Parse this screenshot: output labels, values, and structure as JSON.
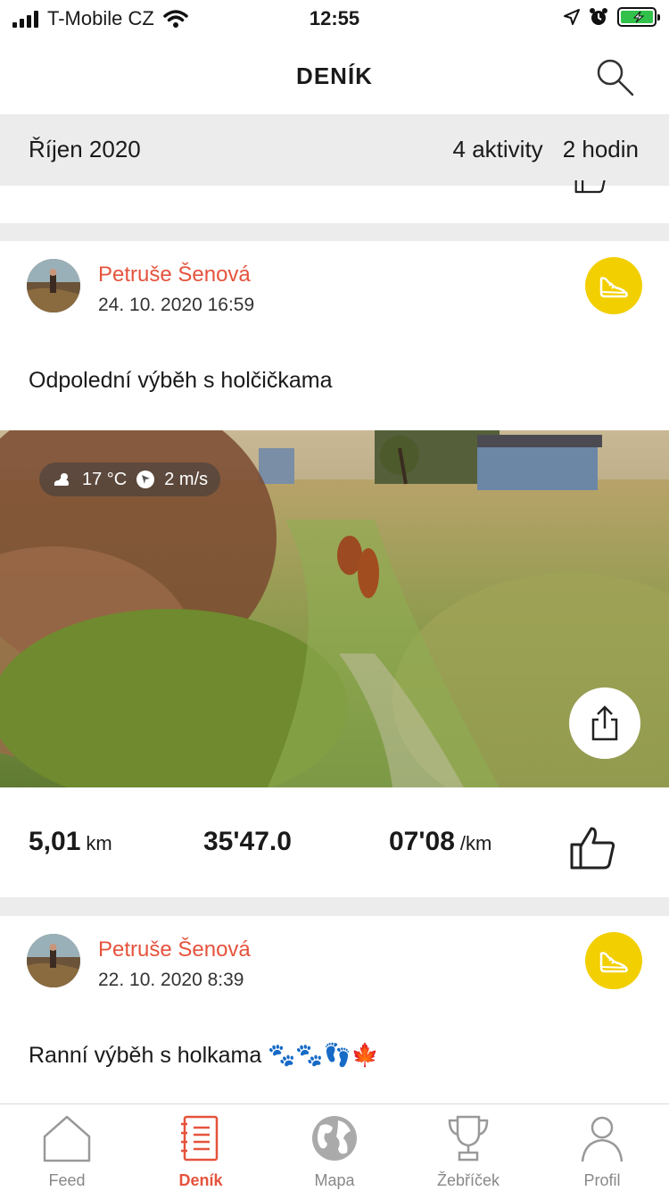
{
  "status_bar": {
    "carrier": "T-Mobile CZ",
    "time": "12:55"
  },
  "header": {
    "title": "DENÍK"
  },
  "month_summary": {
    "month": "Říjen 2020",
    "activities": "4 aktivity",
    "duration": "2 hodin"
  },
  "activities": [
    {
      "user": "Petruše Šenová",
      "date": "24. 10. 2020 16:59",
      "description": "Odpolední výběh s holčičkama",
      "sport_icon": "running-shoe-icon",
      "weather": {
        "temperature": "17 °C",
        "wind": "2 m/s"
      },
      "stats": {
        "distance": "5,01",
        "distance_unit": "km",
        "duration": "35'47.0",
        "pace": "07'08",
        "pace_unit": "/km"
      }
    },
    {
      "user": "Petruše Šenová",
      "date": "22. 10. 2020 8:39",
      "description": "Ranní výběh s holkama 🐾🐾👣🍁",
      "sport_icon": "running-shoe-icon"
    }
  ],
  "tabs": [
    {
      "label": "Feed",
      "icon": "home-icon"
    },
    {
      "label": "Deník",
      "icon": "notebook-icon",
      "active": true
    },
    {
      "label": "Mapa",
      "icon": "globe-icon"
    },
    {
      "label": "Žebříček",
      "icon": "trophy-icon"
    },
    {
      "label": "Profil",
      "icon": "person-icon"
    }
  ],
  "colors": {
    "accent": "#e5533d",
    "sport_badge": "#f2cf00",
    "battery": "#32c24b"
  }
}
